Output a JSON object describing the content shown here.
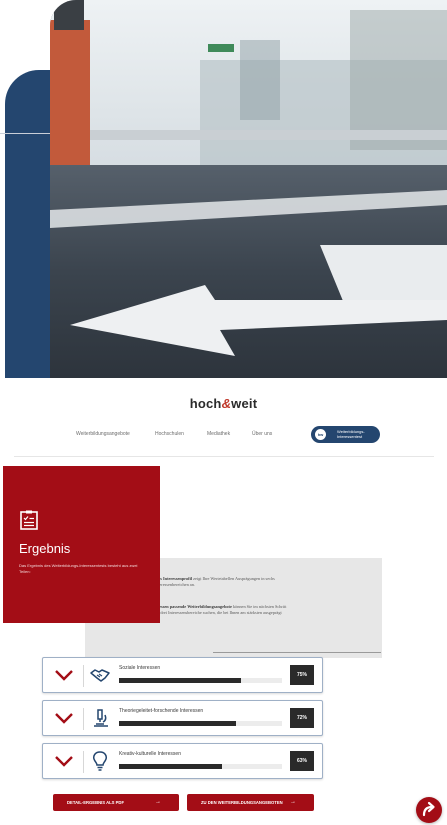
{
  "brand": {
    "name_left": "hoch",
    "name_amp": "&",
    "name_right": "weit"
  },
  "nav": {
    "items": [
      "Weiterbildungsangebote",
      "Hochschulen",
      "Mediathek",
      "Über uns"
    ],
    "button_label": "Weiterbildungs-Interessentest",
    "button_badge": "hw"
  },
  "result_card": {
    "title": "Ergebnis",
    "description": "Das Ergebnis des Weiterbildungs-Interessentests besteht aus zwei Teilen:"
  },
  "info_panel": {
    "point1_bold": "1. Ihr persönliches Interessenprofil",
    "point1_text": "zeigt Ihre Wertetabellen Ausprägungen in sechs grundlegenden Interessenbereichen an.",
    "point2_bold": "2. Zu Ihren Interessen passende Weiterbildungsangebote",
    "point2_text": "können Sie im nächsten Schritt auf Grundlage der drei Interessensbereiche suchen, die bei Ihnen am stärksten ausgeprägt sind."
  },
  "interests": [
    {
      "label": "Soziale Interessen",
      "percent_text": "75%",
      "value": 0.75,
      "icon": "handshake-icon"
    },
    {
      "label": "Theoriegeleitet-forschende Interessen",
      "percent_text": "72%",
      "value": 0.72,
      "icon": "microscope-icon"
    },
    {
      "label": "Kreativ-kulturelle Interessen",
      "percent_text": "63%",
      "value": 0.63,
      "icon": "lightbulb-icon"
    }
  ],
  "actions": {
    "pdf_label": "DETAIL-ERGEBNIS ALS PDF",
    "offers_label": "ZU DEN WEITERBILDUNGSANGEBOTEN",
    "arrow": "→"
  },
  "colors": {
    "brand_red": "#a30d16",
    "navy": "#24466f",
    "bar_dark": "#2a2a2a"
  }
}
